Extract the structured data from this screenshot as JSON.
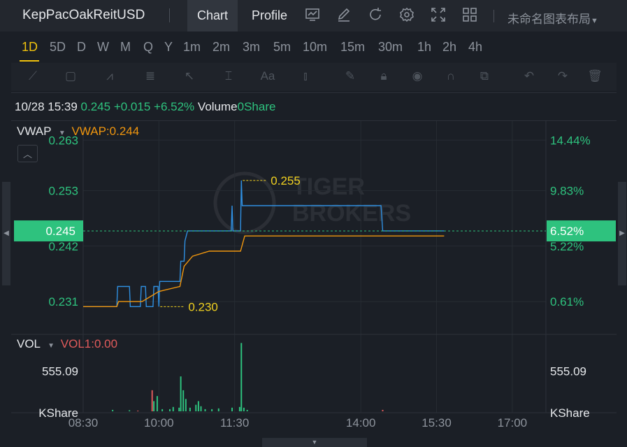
{
  "toolbar": {
    "symbol": "KepPacOakReitUSD",
    "tabs": [
      "Chart",
      "Profile"
    ],
    "layout_label": "未命名图表布局",
    "icons": [
      "chart-type-icon",
      "draw-icon",
      "refresh-icon",
      "settings-icon",
      "fullscreen-icon",
      "grid-layout-icon"
    ]
  },
  "periods": [
    "1D",
    "5D",
    "D",
    "W",
    "M",
    "Q",
    "Y",
    "1m",
    "2m",
    "3m",
    "5m",
    "10m",
    "15m",
    "30m",
    "1h",
    "2h",
    "4h"
  ],
  "active_period": "1D",
  "quote": {
    "datetime": "10/28 15:39",
    "price": "0.245",
    "change": "+0.015",
    "change_pct": "+6.52%",
    "volume_label": "Volume",
    "volume": "0Share"
  },
  "watermark": "TIGER BROKERS",
  "colors": {
    "price_line": "#2f8fe0",
    "vwap_line": "#f0960e",
    "up": "#2ec27e",
    "down": "#e15b5b",
    "highlight": "#f0d020"
  },
  "chart_data": [
    {
      "type": "line",
      "series": [
        {
          "name": "",
          "points": [
            [
              "08:30",
              0.23
            ],
            [
              "09:10",
              0.23
            ],
            [
              "09:11",
              0.234
            ],
            [
              "09:25",
              0.234
            ],
            [
              "09:26",
              0.23
            ],
            [
              "09:38",
              0.23
            ],
            [
              "09:39",
              0.234
            ],
            [
              "09:44",
              0.234
            ],
            [
              "09:45",
              0.23
            ],
            [
              "09:53",
              0.23
            ],
            [
              "09:54",
              0.234
            ],
            [
              "09:59",
              0.234
            ],
            [
              "10:00",
              0.23
            ],
            [
              "10:01",
              0.235
            ],
            [
              "10:25",
              0.235
            ],
            [
              "10:26",
              0.239
            ],
            [
              "10:30",
              0.239
            ],
            [
              "10:31",
              0.243
            ],
            [
              "10:34",
              0.245
            ],
            [
              "11:26",
              0.245
            ],
            [
              "11:27",
              0.25
            ],
            [
              "11:28",
              0.245
            ],
            [
              "11:37",
              0.245
            ],
            [
              "11:38",
              0.255
            ],
            [
              "11:39",
              0.25
            ],
            [
              "14:24",
              0.25
            ],
            [
              "14:26",
              0.245
            ],
            [
              "15:39",
              0.245
            ]
          ]
        },
        {
          "name": "VWAP",
          "points": [
            [
              "08:30",
              0.23
            ],
            [
              "09:10",
              0.23
            ],
            [
              "09:12",
              0.231
            ],
            [
              "09:40",
              0.231
            ],
            [
              "09:50",
              0.232
            ],
            [
              "10:00",
              0.233
            ],
            [
              "10:25",
              0.234
            ],
            [
              "10:30",
              0.238
            ],
            [
              "10:40",
              0.24
            ],
            [
              "11:00",
              0.241
            ],
            [
              "11:37",
              0.241
            ],
            [
              "11:42",
              0.244
            ],
            [
              "13:00",
              0.244
            ],
            [
              "15:39",
              0.244
            ]
          ]
        }
      ],
      "indicator_label": "VWAP",
      "indicator_value": "VWAP:0.244",
      "y_ticks_left": [
        "0.263",
        "0.253",
        "0.242",
        "0.231"
      ],
      "y_ticks_right": [
        "14.44%",
        "9.83%",
        "5.22%",
        "0.61%"
      ],
      "ylim": [
        0.2245,
        0.2665
      ],
      "annotations": [
        {
          "label": "0.255",
          "x": "11:38",
          "y": 0.255
        },
        {
          "label": "0.230",
          "x": "10:00",
          "y": 0.23
        }
      ],
      "current_price_label": "0.245",
      "current_pct_label": "6.52%",
      "current_price": 0.245,
      "xlim": [
        "08:30",
        "17:40"
      ],
      "grid": true
    },
    {
      "type": "bar",
      "indicator_label": "VOL",
      "indicator_value": "VOL1:0.00",
      "y_ticks_left": [
        "555.09",
        "KShare"
      ],
      "y_ticks_right": [
        "555.09",
        "KShare"
      ],
      "y_tick_value": 555.09,
      "ylim": [
        0,
        1020
      ],
      "x_ticks": [
        "08:30",
        "10:00",
        "11:30",
        "14:00",
        "15:30",
        "17:00"
      ],
      "bars": [
        {
          "x": "09:05",
          "v": 20,
          "dir": "up"
        },
        {
          "x": "09:25",
          "v": 15,
          "dir": "up"
        },
        {
          "x": "09:35",
          "v": 10,
          "dir": "down"
        },
        {
          "x": "09:52",
          "v": 290,
          "dir": "down"
        },
        {
          "x": "09:54",
          "v": 140,
          "dir": "up"
        },
        {
          "x": "09:58",
          "v": 210,
          "dir": "up"
        },
        {
          "x": "10:04",
          "v": 30,
          "dir": "up"
        },
        {
          "x": "10:13",
          "v": 30,
          "dir": "up"
        },
        {
          "x": "10:17",
          "v": 60,
          "dir": "up"
        },
        {
          "x": "10:24",
          "v": 50,
          "dir": "up"
        },
        {
          "x": "10:26",
          "v": 480,
          "dir": "up"
        },
        {
          "x": "10:29",
          "v": 290,
          "dir": "up"
        },
        {
          "x": "10:32",
          "v": 170,
          "dir": "up"
        },
        {
          "x": "10:37",
          "v": 50,
          "dir": "up"
        },
        {
          "x": "10:44",
          "v": 90,
          "dir": "up"
        },
        {
          "x": "10:47",
          "v": 140,
          "dir": "up"
        },
        {
          "x": "10:50",
          "v": 70,
          "dir": "up"
        },
        {
          "x": "10:55",
          "v": 30,
          "dir": "up"
        },
        {
          "x": "11:03",
          "v": 30,
          "dir": "up"
        },
        {
          "x": "11:11",
          "v": 40,
          "dir": "up"
        },
        {
          "x": "11:27",
          "v": 50,
          "dir": "up"
        },
        {
          "x": "11:36",
          "v": 60,
          "dir": "up"
        },
        {
          "x": "11:38",
          "v": 940,
          "dir": "up"
        },
        {
          "x": "11:41",
          "v": 50,
          "dir": "up"
        },
        {
          "x": "11:45",
          "v": 20,
          "dir": "up"
        },
        {
          "x": "14:26",
          "v": 20,
          "dir": "down"
        }
      ]
    }
  ]
}
